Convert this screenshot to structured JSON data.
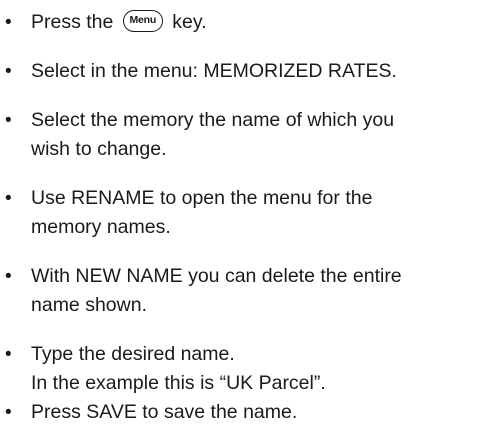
{
  "steps": [
    {
      "before_key": "Press the",
      "key_label": "Menu",
      "after_key": "key."
    },
    {
      "lines": [
        "Select in the menu: MEMORIZED RATES."
      ]
    },
    {
      "lines": [
        "Select the memory the name of which you",
        "wish to change."
      ]
    },
    {
      "lines": [
        "Use RENAME to open the menu for the",
        "memory names."
      ]
    },
    {
      "lines": [
        "With NEW NAME you can delete the entire",
        "name shown."
      ]
    },
    {
      "lines": [
        "Type the desired name.",
        "In the example this is “UK Parcel”."
      ]
    },
    {
      "lines": [
        "Press SAVE to save the name."
      ]
    }
  ]
}
